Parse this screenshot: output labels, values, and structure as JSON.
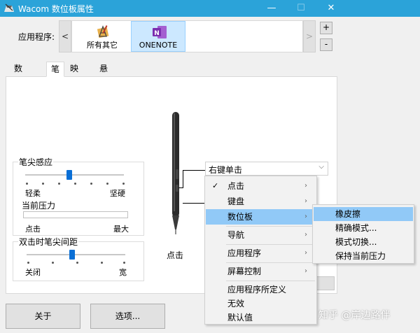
{
  "window": {
    "title": "Wacom 数位板属性",
    "controls": {
      "minimize": "—",
      "maximize": "☐",
      "close": "✕"
    }
  },
  "apps_bar": {
    "label": "应用程序:",
    "scroll_left": "<",
    "scroll_right": ">",
    "add": "+",
    "remove": "-",
    "apps": [
      {
        "label": "所有其它",
        "icon": "all-apps-icon"
      },
      {
        "label": "ONENOTE",
        "icon": "onenote-icon",
        "selected": true
      }
    ]
  },
  "tabs": [
    {
      "label": "数位板"
    },
    {
      "label": "笔",
      "selected": true
    },
    {
      "label": "映射"
    },
    {
      "label": "悬窗快捷键"
    }
  ],
  "tip_feel": {
    "title": "笔尖感应",
    "soft": "轻柔",
    "firm": "坚硬",
    "pressure_label": "当前压力",
    "click": "点击",
    "max": "最大",
    "slider_value": 0.45
  },
  "double_click": {
    "title": "双击时笔尖间距",
    "off": "关闭",
    "wide": "宽",
    "slider_value": 0.46
  },
  "pen": {
    "tip_caption": "点击"
  },
  "button_dropdown": {
    "value": "右键单击",
    "arrow": "⌵"
  },
  "context_menu": {
    "items": [
      {
        "label": "点击",
        "checked": true,
        "submenu": true
      },
      {
        "label": "键盘",
        "submenu": true
      },
      {
        "label": "数位板",
        "submenu": true,
        "highlighted": true
      },
      {
        "label": "导航",
        "submenu": true
      },
      {
        "label": "应用程序",
        "submenu": true
      },
      {
        "label": "屏幕控制",
        "submenu": true
      },
      {
        "label": "应用程序所定义"
      },
      {
        "label": "无效"
      },
      {
        "label": "默认值"
      }
    ],
    "check_glyph": "✓",
    "submenu_glyph": "›"
  },
  "tablet_submenu": {
    "items": [
      {
        "label": "橡皮擦",
        "highlighted": true
      },
      {
        "label": "精确模式..."
      },
      {
        "label": "模式切换..."
      },
      {
        "label": "保持当前压力"
      }
    ]
  },
  "footer": {
    "about": "关于",
    "options": "选项..."
  },
  "watermark": "知乎 @岸边路伴",
  "colors": {
    "titlebar": "#2ba3d9",
    "highlight": "#91c9f7",
    "slider_thumb": "#0a6fd6",
    "onenote": "#7b2fb0"
  }
}
